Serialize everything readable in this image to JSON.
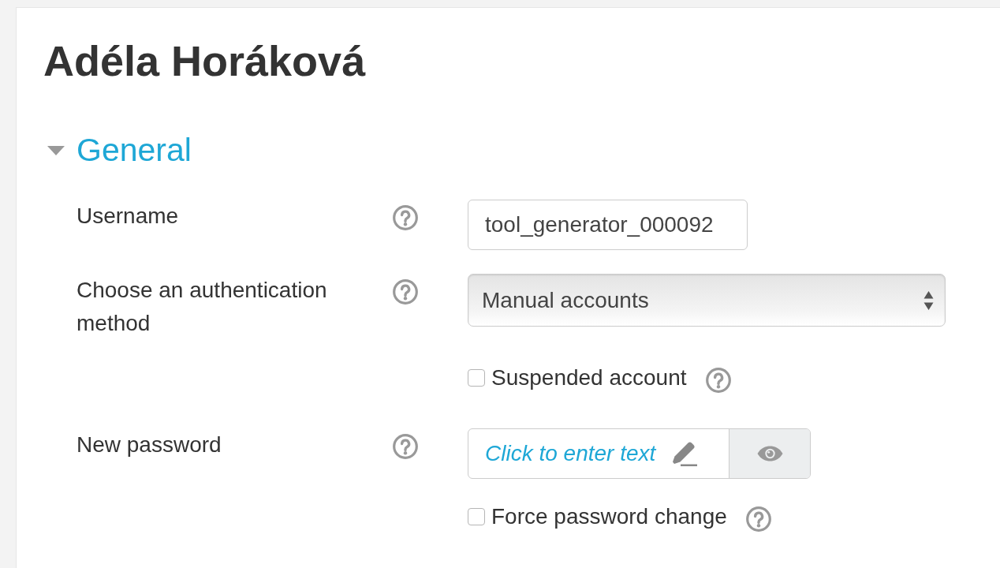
{
  "page_title": "Adéla Horáková",
  "section": {
    "title": "General",
    "expanded": true,
    "fields": [
      {
        "kind": "text",
        "label": "Username",
        "help": true,
        "value": "tool_generator_000092"
      },
      {
        "kind": "select",
        "label": "Choose an authentication method",
        "help": true,
        "value": "Manual accounts"
      },
      {
        "kind": "checkbox",
        "label": "Suspended account",
        "help": true,
        "checked": false
      },
      {
        "kind": "password",
        "label": "New password",
        "help": true,
        "link": "Click to enter text"
      },
      {
        "kind": "checkbox",
        "label": "Force password change",
        "help": true,
        "checked": false
      }
    ]
  }
}
